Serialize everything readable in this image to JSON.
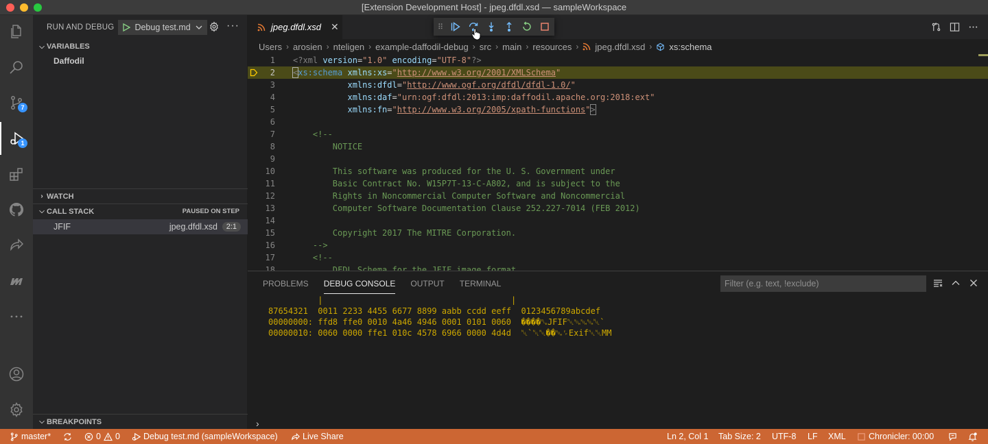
{
  "window": {
    "title": "[Extension Development Host] - jpeg.dfdl.xsd — sampleWorkspace"
  },
  "activity": {
    "items": [
      "explorer-icon",
      "search-icon",
      "source-control-icon",
      "run-debug-icon",
      "extensions-icon",
      "github-icon",
      "live-share-icon",
      "marketplace-icon",
      "more-icon",
      "account-icon",
      "manage-gear-icon"
    ],
    "scm_badge": "7",
    "debug_badge": "1"
  },
  "sidebar": {
    "title": "RUN AND DEBUG",
    "config": "Debug test.md",
    "variables_title": "VARIABLES",
    "variables_scope": "Daffodil",
    "watch_title": "WATCH",
    "callstack_title": "CALL STACK",
    "callstack_status": "PAUSED ON STEP",
    "stack": {
      "function": "JFIF",
      "file": "jpeg.dfdl.xsd",
      "position": "2:1"
    },
    "breakpoints_title": "BREAKPOINTS"
  },
  "editor": {
    "tab_label": "jpeg.dfdl.xsd",
    "breadcrumb": [
      "Users",
      "arosien",
      "nteligen",
      "example-daffodil-debug",
      "src",
      "main",
      "resources",
      "jpeg.dfdl.xsd",
      "xs:schema"
    ],
    "current_line": 2,
    "lines": [
      {
        "n": "1",
        "parts": [
          [
            "pi",
            "<?xml "
          ],
          [
            "attr",
            "version"
          ],
          [
            "eq",
            "="
          ],
          [
            "str",
            "\"1.0\""
          ],
          [
            "attr",
            " encoding"
          ],
          [
            "eq",
            "="
          ],
          [
            "str",
            "\"UTF-8\""
          ],
          [
            "pi",
            "?>"
          ]
        ]
      },
      {
        "n": "2",
        "parts": [
          [
            "br",
            "<"
          ],
          [
            "tag",
            "xs:schema"
          ],
          [
            "attr",
            " xmlns:xs"
          ],
          [
            "eq",
            "="
          ],
          [
            "str",
            "\""
          ],
          [
            "url",
            "http://www.w3.org/2001/XMLSchema"
          ],
          [
            "str",
            "\""
          ]
        ]
      },
      {
        "n": "3",
        "parts": [
          [
            "attr",
            "           xmlns:dfdl"
          ],
          [
            "eq",
            "="
          ],
          [
            "str",
            "\""
          ],
          [
            "url",
            "http://www.ogf.org/dfdl/dfdl-1.0/"
          ],
          [
            "str",
            "\""
          ]
        ]
      },
      {
        "n": "4",
        "parts": [
          [
            "attr",
            "           xmlns:daf"
          ],
          [
            "eq",
            "="
          ],
          [
            "str",
            "\"urn:ogf:dfdl:2013:imp:daffodil.apache.org:2018:ext\""
          ]
        ]
      },
      {
        "n": "5",
        "parts": [
          [
            "attr",
            "           xmlns:fn"
          ],
          [
            "eq",
            "="
          ],
          [
            "str",
            "\""
          ],
          [
            "url",
            "http://www.w3.org/2005/xpath-functions"
          ],
          [
            "str",
            "\""
          ],
          [
            "br",
            ">"
          ]
        ]
      },
      {
        "n": "6",
        "parts": []
      },
      {
        "n": "7",
        "parts": [
          [
            "com",
            "    <!--"
          ]
        ]
      },
      {
        "n": "8",
        "parts": [
          [
            "com",
            "        NOTICE"
          ]
        ]
      },
      {
        "n": "9",
        "parts": []
      },
      {
        "n": "10",
        "parts": [
          [
            "com",
            "        This software was produced for the U. S. Government under"
          ]
        ]
      },
      {
        "n": "11",
        "parts": [
          [
            "com",
            "        Basic Contract No. W15P7T-13-C-A802, and is subject to the"
          ]
        ]
      },
      {
        "n": "12",
        "parts": [
          [
            "com",
            "        Rights in Noncommercial Computer Software and Noncommercial"
          ]
        ]
      },
      {
        "n": "13",
        "parts": [
          [
            "com",
            "        Computer Software Documentation Clause 252.227-7014 (FEB 2012)"
          ]
        ]
      },
      {
        "n": "14",
        "parts": []
      },
      {
        "n": "15",
        "parts": [
          [
            "com",
            "        Copyright 2017 The MITRE Corporation."
          ]
        ]
      },
      {
        "n": "16",
        "parts": [
          [
            "com",
            "    -->"
          ]
        ]
      },
      {
        "n": "17",
        "parts": [
          [
            "com",
            "    <!--"
          ]
        ]
      },
      {
        "n": "18",
        "parts": [
          [
            "com",
            "        DFDL Schema for the JFIF image format"
          ]
        ]
      }
    ]
  },
  "panel": {
    "tabs": [
      "PROBLEMS",
      "DEBUG CONSOLE",
      "OUTPUT",
      "TERMINAL"
    ],
    "active_tab": "DEBUG CONSOLE",
    "filter_placeholder": "Filter (e.g. text, !exclude)",
    "console_lines": [
      "          |                                      |",
      "87654321  0011 2233 4455 6677 8899 aabb ccdd eeff  0123456789abcdef",
      "00000000: ffd8 ffe0 0010 4a46 4946 0001 0101 0060  ����␐JFIF␀␁␁␁␀`",
      "00000010: 0060 0000 ffe1 010c 4578 6966 0000 4d4d  ␀`␀␀��␁␌Exif␀␀MM"
    ],
    "prompt": "›"
  },
  "status": {
    "branch": "master*",
    "errors": "0",
    "warnings": "0",
    "debug": "Debug test.md (sampleWorkspace)",
    "liveshare": "Live Share",
    "position": "Ln 2, Col 1",
    "tabsize": "Tab Size: 2",
    "encoding": "UTF-8",
    "eol": "LF",
    "language": "XML",
    "chronicler": "Chronicler: 00:00"
  },
  "colors": {
    "statusbar": "#cc6633",
    "activity_badge": "#3794ff",
    "current_line": "#4b4b18"
  }
}
